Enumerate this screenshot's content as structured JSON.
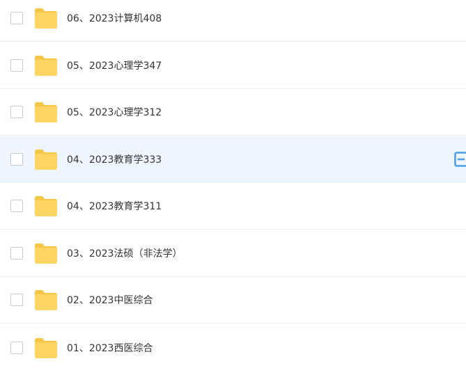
{
  "colors": {
    "folder_body": "#fed463",
    "folder_tab": "#f6c647",
    "row_highlight": "#eef5fd",
    "action_icon": "#4a9de8",
    "text": "#333333"
  },
  "files": [
    {
      "name": "06、2023计算机408",
      "icon": "folder-icon",
      "type": "folder"
    },
    {
      "name": "05、2023心理学347",
      "icon": "folder-icon",
      "type": "folder"
    },
    {
      "name": "05、2023心理学312",
      "icon": "folder-icon",
      "type": "folder"
    },
    {
      "name": "04、2023教育学333",
      "icon": "folder-icon",
      "type": "folder",
      "highlighted": true,
      "action_icon": "share-icon"
    },
    {
      "name": "04、2023教育学311",
      "icon": "folder-icon",
      "type": "folder"
    },
    {
      "name": "03、2023法硕（非法学）",
      "icon": "folder-icon",
      "type": "folder"
    },
    {
      "name": "02、2023中医综合",
      "icon": "folder-icon",
      "type": "folder"
    },
    {
      "name": "01、2023西医综合",
      "icon": "folder-icon",
      "type": "folder"
    }
  ]
}
